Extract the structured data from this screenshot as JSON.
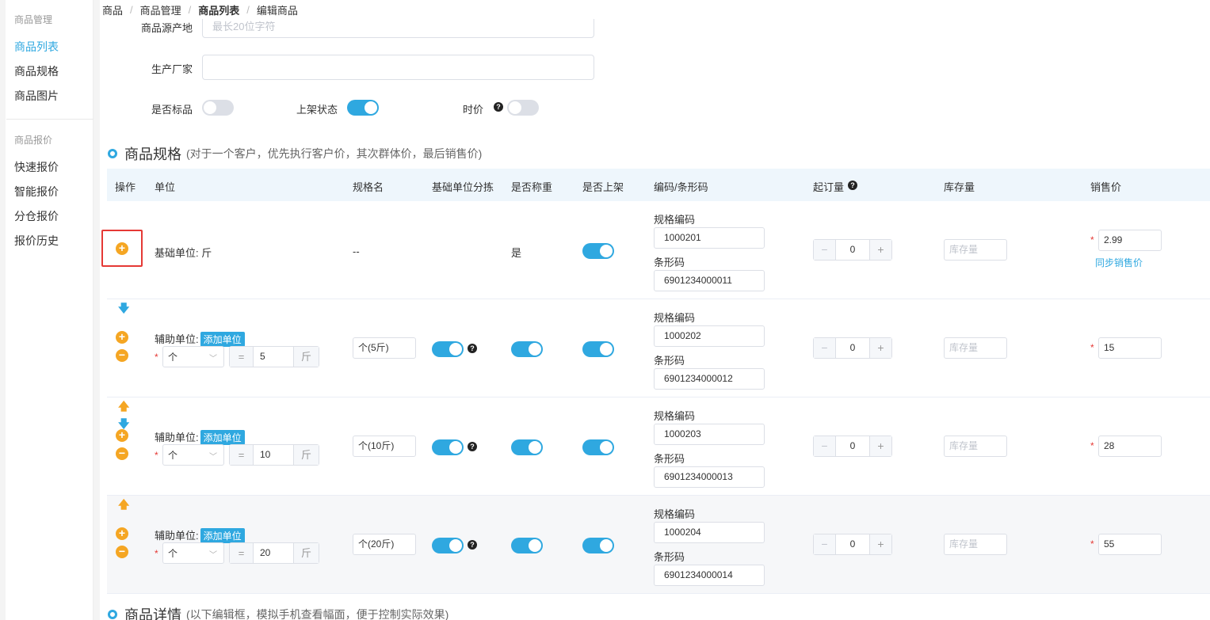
{
  "sidebar": {
    "group1": "商品管理",
    "items1": [
      {
        "label": "商品列表",
        "active": true
      },
      {
        "label": "商品规格"
      },
      {
        "label": "商品图片"
      }
    ],
    "group2": "商品报价",
    "items2": [
      {
        "label": "快速报价"
      },
      {
        "label": "智能报价"
      },
      {
        "label": "分仓报价"
      },
      {
        "label": "报价历史"
      }
    ]
  },
  "breadcrumb": [
    "商品",
    "商品管理",
    "商品列表",
    "编辑商品"
  ],
  "form": {
    "origin_label": "商品源产地",
    "origin_placeholder": "最长20位字符",
    "maker_label": "生产厂家",
    "maker_value": "",
    "standard_label": "是否标品",
    "standard_on": false,
    "listed_label": "上架状态",
    "listed_on": true,
    "market_price_label": "时价",
    "market_price_on": false
  },
  "spec_section": {
    "title": "商品规格",
    "subtitle": "(对于一个客户，优先执行客户价，其次群体价，最后销售价)"
  },
  "table": {
    "headers": [
      "操作",
      "单位",
      "规格名",
      "基础单位分拣",
      "是否称重",
      "是否上架",
      "编码/条形码",
      "起订量",
      "库存量",
      "销售价"
    ],
    "spec_code_label": "规格编码",
    "barcode_label": "条形码",
    "stock_placeholder": "库存量",
    "sync_price_label": "同步销售价",
    "add_unit_tag": "添加单位",
    "aux_unit_label": "辅助单位:",
    "base_unit_label": "基础单位: 斤",
    "rows": [
      {
        "spec_name": "--",
        "weigh": "是",
        "spec_code": "1000201",
        "barcode": "6901234000011",
        "moq": "0",
        "price": "2.99"
      },
      {
        "unit": "个",
        "qty": "5",
        "unit_of": "斤",
        "spec_name": "个(5斤)",
        "spec_code": "1000202",
        "barcode": "6901234000012",
        "moq": "0",
        "price": "15"
      },
      {
        "unit": "个",
        "qty": "10",
        "unit_of": "斤",
        "spec_name": "个(10斤)",
        "spec_code": "1000203",
        "barcode": "6901234000013",
        "moq": "0",
        "price": "28"
      },
      {
        "unit": "个",
        "qty": "20",
        "unit_of": "斤",
        "spec_name": "个(20斤)",
        "spec_code": "1000204",
        "barcode": "6901234000014",
        "moq": "0",
        "price": "55"
      }
    ]
  },
  "detail_section": {
    "title": "商品详情",
    "subtitle": "(以下编辑框，模拟手机查看幅面，便于控制实际效果)"
  },
  "colors": {
    "accent": "#2fa8e0",
    "orange": "#f5a623",
    "red": "#e53935"
  }
}
